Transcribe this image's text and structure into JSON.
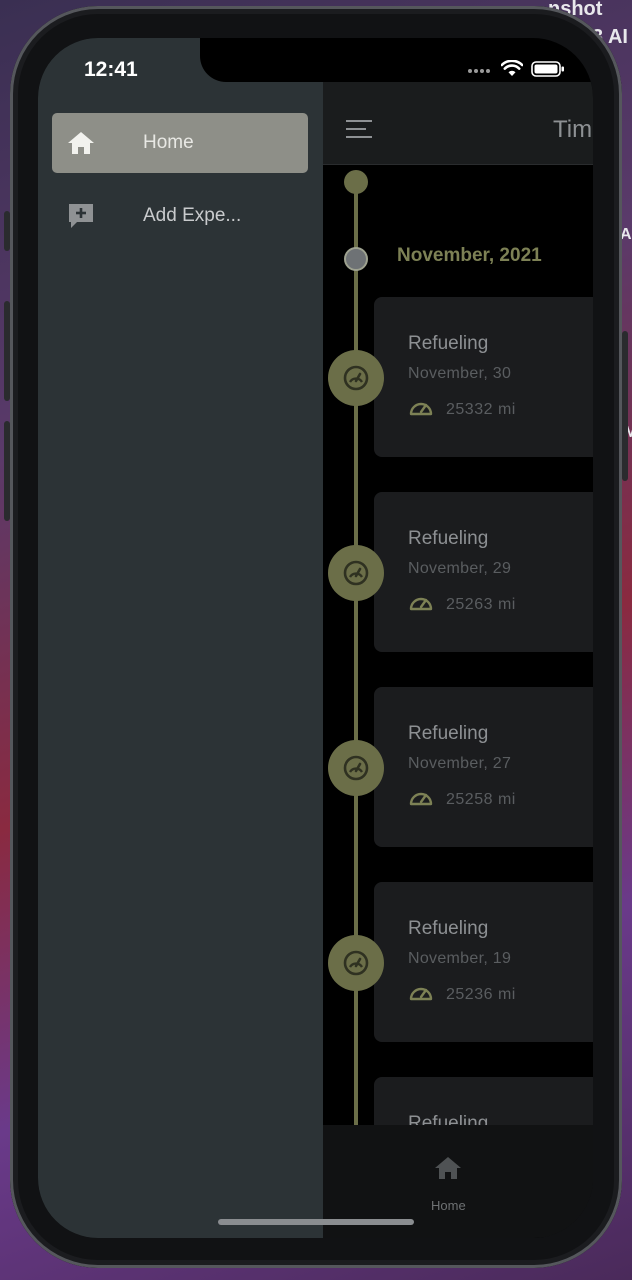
{
  "desktop": {
    "label_top": "nshot",
    "label_second": "3 AI",
    "label_side1": "AI",
    "label_side2": "M"
  },
  "status_bar": {
    "time": "12:41"
  },
  "app_bar": {
    "title": "Tim"
  },
  "timeline": {
    "month": "November, 2021",
    "events": [
      {
        "title": "Refueling",
        "date": "November, 30",
        "odometer": "25332 mi"
      },
      {
        "title": "Refueling",
        "date": "November, 29",
        "odometer": "25263 mi"
      },
      {
        "title": "Refueling",
        "date": "November, 27",
        "odometer": "25258 mi"
      },
      {
        "title": "Refueling",
        "date": "November, 19",
        "odometer": "25236 mi"
      },
      {
        "title": "Refueling"
      }
    ]
  },
  "bottom_nav": {
    "home_label": "Home"
  },
  "drawer": {
    "items": [
      {
        "label": "Home",
        "icon": "home-icon",
        "active": true
      },
      {
        "label": "Add Expe...",
        "icon": "add-comment-icon",
        "active": false
      }
    ]
  },
  "colors": {
    "accent": "#6b6e48",
    "drawer_bg": "#2c3336",
    "active_item_bg": "#8e8f88",
    "card_bg": "#1b1c1e"
  }
}
